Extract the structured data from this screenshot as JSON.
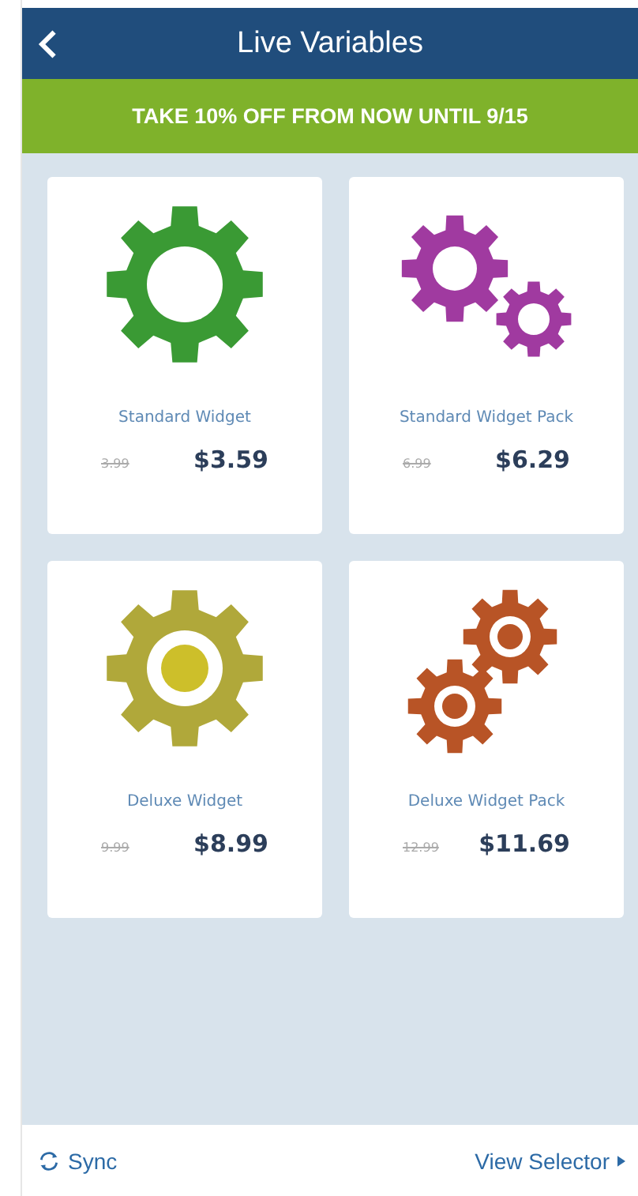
{
  "header": {
    "title": "Live Variables"
  },
  "banner": "TAKE 10% OFF FROM NOW UNTIL 9/15",
  "products": [
    {
      "name": "Standard Widget",
      "old_price": "3.99",
      "price": "$3.59",
      "kind": "gear",
      "color": "#3a9a34"
    },
    {
      "name": "Standard Widget Pack",
      "old_price": "6.99",
      "price": "$6.29",
      "kind": "gear-pair",
      "color": "#a03aa0"
    },
    {
      "name": "Deluxe Widget",
      "old_price": "9.99",
      "price": "$8.99",
      "kind": "gear-core",
      "color": "#b0a83a"
    },
    {
      "name": "Deluxe Widget Pack",
      "old_price": "12.99",
      "price": "$11.69",
      "kind": "gear-pair-core",
      "color": "#b85426"
    }
  ],
  "footer": {
    "left": "Sync",
    "right": "View Selector"
  }
}
